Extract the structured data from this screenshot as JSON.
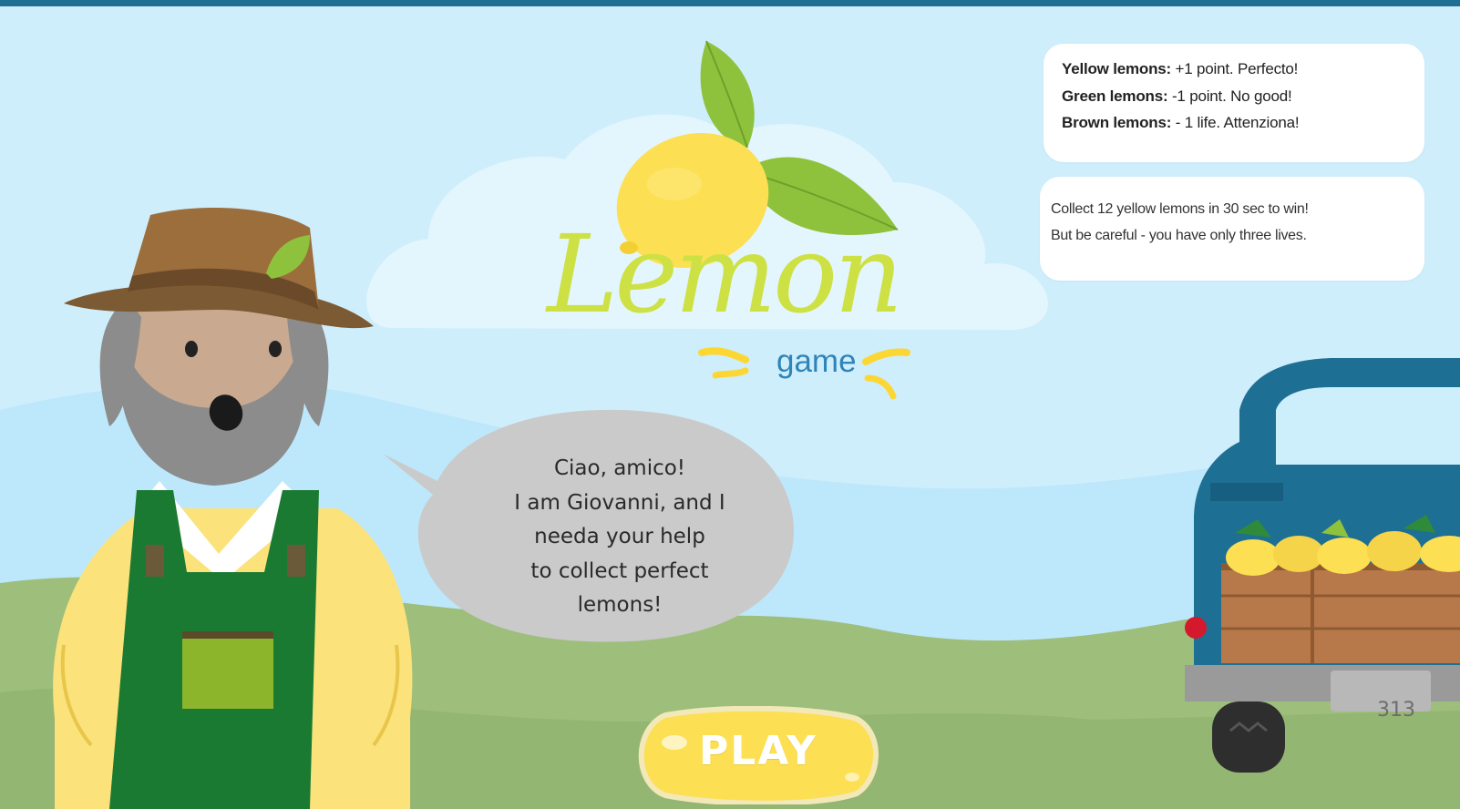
{
  "rules": {
    "yellow": {
      "label": "Yellow lemons:",
      "text": " +1 point. Perfecto!"
    },
    "green": {
      "label": "Green lemons:",
      "text": " -1 point. No good!"
    },
    "brown": {
      "label": "Brown lemons:",
      "text": " - 1 life. Attenziona!"
    }
  },
  "goal": {
    "line1": "Collect 12 yellow lemons in 30 sec to win!",
    "line2": "But be careful - you have only three lives."
  },
  "logo": {
    "title": "Lemon",
    "subtitle": "game"
  },
  "speech": {
    "lines": [
      "Ciao, amico!",
      "I am Giovanni, and I",
      "needa your help",
      "to collect perfect",
      "lemons!"
    ]
  },
  "play_button": {
    "label": "PLAY"
  },
  "truck": {
    "plate": "313"
  },
  "colors": {
    "sky": "#cfeefc",
    "hill": "#9ebe7c",
    "lemon_yellow": "#fcdf52",
    "logo_green": "#cde145",
    "overalls": "#1a7a32",
    "truck_blue": "#1e6f94",
    "bubble_gray": "#cacaca"
  }
}
